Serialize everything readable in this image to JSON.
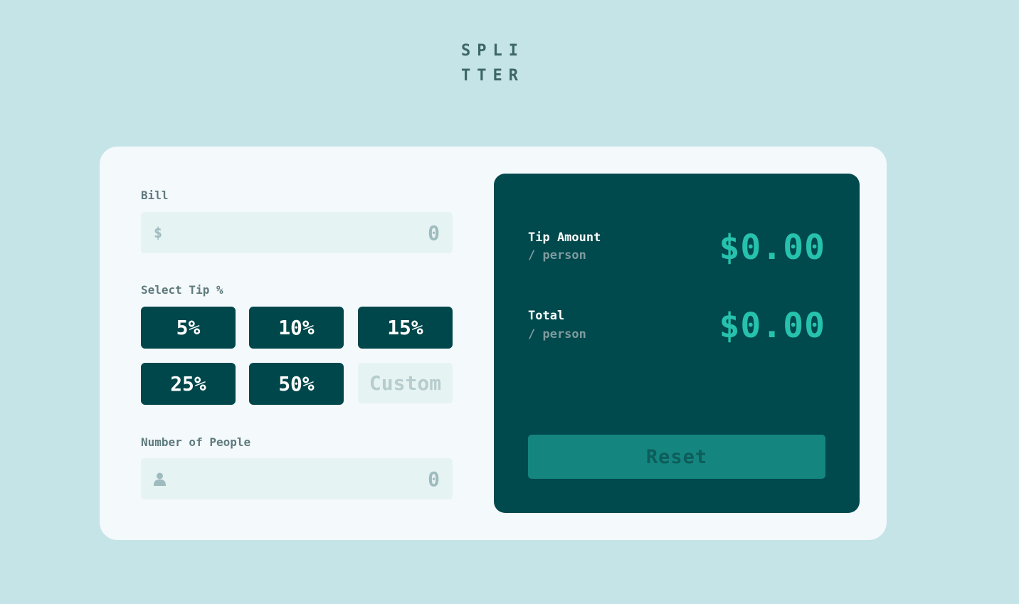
{
  "logo": {
    "line1": "SPLI",
    "line2": "TTER"
  },
  "bill": {
    "label": "Bill",
    "icon": "$",
    "value": "0"
  },
  "tip": {
    "label": "Select Tip %",
    "options": [
      "5%",
      "10%",
      "15%",
      "25%",
      "50%"
    ],
    "custom_placeholder": "Custom"
  },
  "people": {
    "label": "Number of People",
    "value": "0"
  },
  "results": {
    "tip_amount": {
      "title": "Tip Amount",
      "sub": "/ person",
      "value": "$0.00"
    },
    "total": {
      "title": "Total",
      "sub": "/ person",
      "value": "$0.00"
    }
  },
  "reset_label": "Reset",
  "colors": {
    "background": "#c5e4e7",
    "card": "#f4f9fc",
    "dark_cyan": "#00474b",
    "accent": "#26c2ad",
    "reset_button": "#14867f"
  }
}
